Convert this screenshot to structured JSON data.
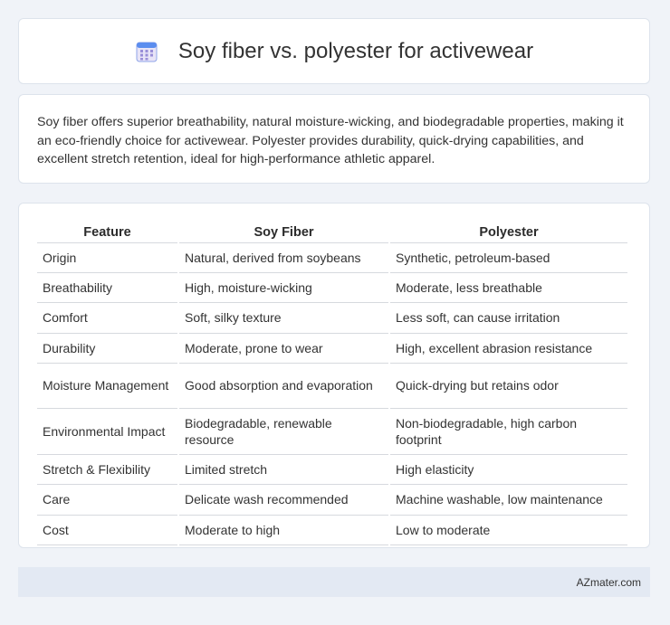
{
  "header": {
    "title": "Soy fiber vs. polyester for activewear",
    "icon": "calendar-icon"
  },
  "intro": {
    "text": "Soy fiber offers superior breathability, natural moisture-wicking, and biodegradable properties, making it an eco-friendly choice for activewear. Polyester provides durability, quick-drying capabilities, and excellent stretch retention, ideal for high-performance athletic apparel."
  },
  "table": {
    "headers": [
      "Feature",
      "Soy Fiber",
      "Polyester"
    ],
    "rows": [
      [
        "Origin",
        "Natural, derived from soybeans",
        "Synthetic, petroleum-based"
      ],
      [
        "Breathability",
        "High, moisture-wicking",
        "Moderate, less breathable"
      ],
      [
        "Comfort",
        "Soft, silky texture",
        "Less soft, can cause irritation"
      ],
      [
        "Durability",
        "Moderate, prone to wear",
        "High, excellent abrasion resistance"
      ],
      [
        "Moisture Management",
        "Good absorption and evaporation",
        "Quick-drying but retains odor"
      ],
      [
        "Environmental Impact",
        "Biodegradable, renewable resource",
        "Non-biodegradable, high carbon footprint"
      ],
      [
        "Stretch & Flexibility",
        "Limited stretch",
        "High elasticity"
      ],
      [
        "Care",
        "Delicate wash recommended",
        "Machine washable, low maintenance"
      ],
      [
        "Cost",
        "Moderate to high",
        "Low to moderate"
      ]
    ]
  },
  "footer": {
    "brand": "AZmater.com"
  }
}
